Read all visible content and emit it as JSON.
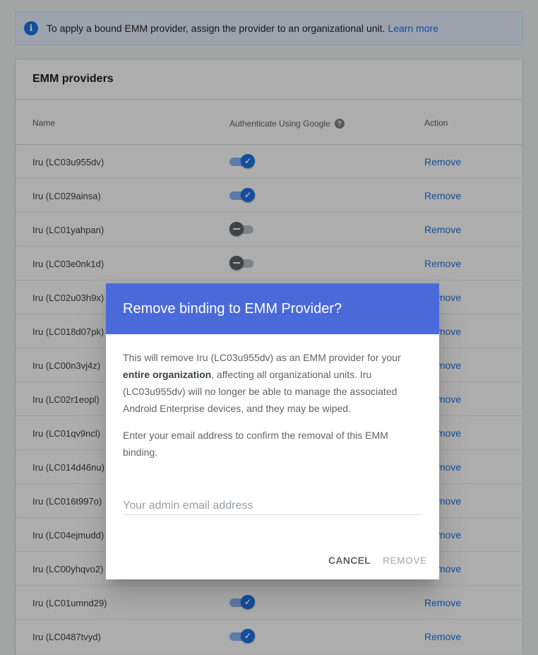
{
  "banner": {
    "text": "To apply a bound EMM provider, assign the provider to an organizational unit.",
    "link": "Learn more",
    "icon": "info-icon"
  },
  "card": {
    "title": "EMM providers",
    "columns": {
      "name": "Name",
      "auth": "Authenticate Using Google",
      "action": "Action"
    },
    "rows": [
      {
        "name": "Iru (LC03u955dv)",
        "auth": "on",
        "action": "Remove"
      },
      {
        "name": "Iru (LC029ainsa)",
        "auth": "on",
        "action": "Remove"
      },
      {
        "name": "Iru (LC01yahpan)",
        "auth": "off",
        "action": "Remove"
      },
      {
        "name": "Iru (LC03e0nk1d)",
        "auth": "off",
        "action": "Remove"
      },
      {
        "name": "Iru (LC02u03h9x)",
        "auth": "hidden",
        "action": "Remove"
      },
      {
        "name": "Iru (LC018d07pk)",
        "auth": "hidden",
        "action": "Remove"
      },
      {
        "name": "Iru (LC00n3vj4z)",
        "auth": "hidden",
        "action": "Remove"
      },
      {
        "name": "Iru (LC02r1eopl)",
        "auth": "hidden",
        "action": "Remove"
      },
      {
        "name": "Iru (LC01qv9ncl)",
        "auth": "hidden",
        "action": "Remove"
      },
      {
        "name": "Iru (LC014d46nu)",
        "auth": "hidden",
        "action": "Remove"
      },
      {
        "name": "Iru (LC016t997o)",
        "auth": "hidden",
        "action": "Remove"
      },
      {
        "name": "Iru (LC04ejmudd)",
        "auth": "hidden",
        "action": "Remove"
      },
      {
        "name": "Iru (LC00yhqvo2)",
        "auth": "hidden",
        "action": "Remove"
      },
      {
        "name": "Iru (LC01umnd29)",
        "auth": "on",
        "action": "Remove"
      },
      {
        "name": "Iru (LC0487tvyd)",
        "auth": "on",
        "action": "Remove"
      }
    ]
  },
  "dialog": {
    "title": "Remove binding to EMM Provider?",
    "p1_before": "This will remove Iru (LC03u955dv) as an EMM provider for your ",
    "p1_bold": "entire organization",
    "p1_after": ", affecting all organizational units. Iru (LC03u955dv) will no longer be able to manage the associated Android Enterprise devices, and they may be wiped.",
    "p2": "Enter your email address to confirm the removal of this EMM binding.",
    "email_placeholder": "Your admin email address",
    "email_value": "",
    "cancel_label": "CANCEL",
    "remove_label": "REMOVE"
  },
  "colors": {
    "accent": "#1a73e8",
    "dialog_header": "#4a6ad9",
    "disabled": "#bdc1c6"
  }
}
